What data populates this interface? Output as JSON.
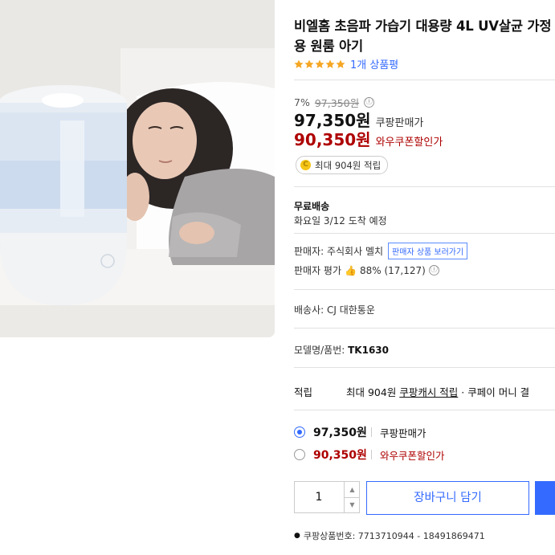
{
  "product": {
    "title": "비엘홈 초음파 가습기 대용량 4L UV살균 가정용 원룸 아기",
    "rating_stars": 5,
    "review_link": "1개 상품평"
  },
  "pricing": {
    "discount_rate": "7%",
    "original_price": "97,350원",
    "info_icon": "ⓘ",
    "sale_price": "97,350원",
    "sale_label": "쿠팡판매가",
    "coupon_price": "90,350원",
    "coupon_label": "와우쿠폰할인가",
    "cash_badge_icon": "C",
    "cash_badge": "최대 904원 적립"
  },
  "shipping": {
    "title": "무료배송",
    "arrival": "화요일 3/12 도착 예정"
  },
  "seller": {
    "label": "판매자: 주식회사 멜치",
    "button": "판매자 상품 보러가기",
    "eval_label": "판매자 평가",
    "eval_value": "88% (17,127)"
  },
  "courier": "배송사: CJ 대한통운",
  "model": {
    "label": "모델명/품번:",
    "value": "TK1630"
  },
  "earning": {
    "label": "적립",
    "text1": "최대 904원 ",
    "link": "쿠팡캐시 적립",
    "text2": " · 쿠페이 머니 결"
  },
  "options": [
    {
      "price": "97,350원",
      "label": "쿠팡판매가",
      "selected": true
    },
    {
      "price": "90,350원",
      "label": "와우쿠폰할인가",
      "selected": false
    }
  ],
  "purchase": {
    "quantity": "1",
    "cart_button": "장바구니 담기"
  },
  "product_id": "쿠팡상품번호: 7713710944 - 18491869471",
  "colors": {
    "accent": "#346aff",
    "coupon_red": "#ae0000",
    "star": "#f5a623"
  }
}
